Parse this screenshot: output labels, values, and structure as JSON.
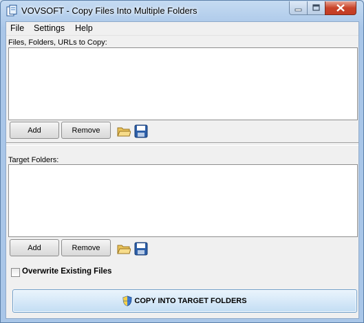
{
  "window": {
    "title": "VOVSOFT - Copy Files Into Multiple Folders"
  },
  "menu": [
    "File",
    "Settings",
    "Help"
  ],
  "sources": {
    "label": "Files, Folders, URLs to Copy:",
    "add_label": "Add",
    "remove_label": "Remove"
  },
  "targets": {
    "label": "Target Folders:",
    "add_label": "Add",
    "remove_label": "Remove"
  },
  "overwrite": {
    "label": "Overwrite Existing Files",
    "checked": false
  },
  "copy_button": {
    "label": "COPY INTO TARGET FOLDERS"
  },
  "icons": {
    "app": "copy-files-app-icon",
    "open": "folder-open-icon",
    "save": "floppy-disk-icon",
    "shield": "uac-shield-icon"
  },
  "colors": {
    "titlebar": "#b9d1ea",
    "close": "#c7432b",
    "copy_button": "#d7e9f8"
  }
}
